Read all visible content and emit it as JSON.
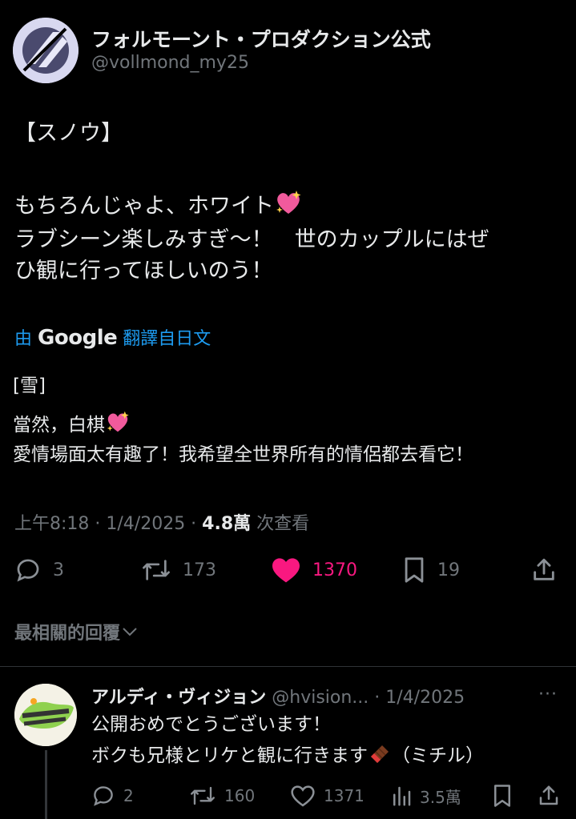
{
  "tweet": {
    "author_name": "フォルモーント・プロダクション公式",
    "author_handle": "@vollmond_my25",
    "body_line1": "【スノウ】",
    "body_line2": "もちろんじゃよ、ホワイト",
    "body_line3": "ラブシーン楽しみすぎ〜！　世のカップルにはぜ",
    "body_line4": "ひ観に行ってほしいのう！",
    "translate_prefix": "由",
    "translate_brand": "Google",
    "translate_suffix": "翻譯自日文",
    "translated_line1": "[雪]",
    "translated_line2": "當然，白棋",
    "translated_line3": "愛情場面太有趣了！我希望全世界所有的情侶都去看它！",
    "timestamp": "上午8:18 · 1/4/2025 · ",
    "views_count": "4.8萬",
    "views_label": " 次查看",
    "replies": "3",
    "reposts": "173",
    "likes": "1370",
    "bookmarks": "19",
    "heart_color": "#f91880"
  },
  "sort": {
    "label": "最相關的回覆"
  },
  "reply": {
    "author_name": "アルディ・ヴィジョン",
    "author_handle": "@hvision...",
    "date": " · 1/4/2025",
    "text_line1": "公開おめでとうございます！",
    "text_line2": "ボクも兄様とリケと観に行きます",
    "text_line2_suffix": "（ミチル）",
    "replies": "2",
    "reposts": "160",
    "likes": "1371",
    "views": "3.5萬"
  }
}
